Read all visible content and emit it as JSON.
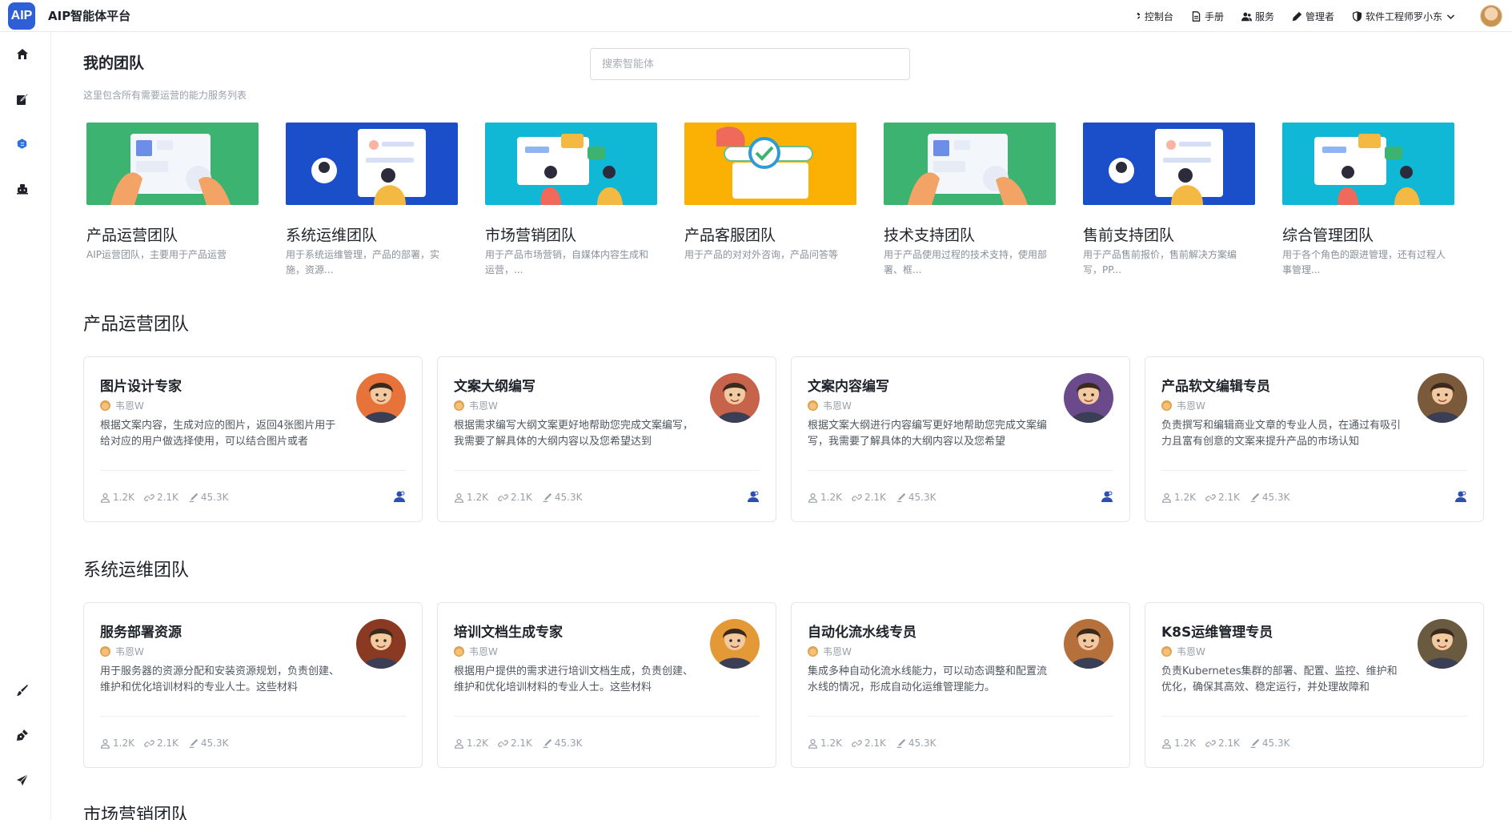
{
  "app": {
    "logo_text": "AIP",
    "title": "AIP智能体平台"
  },
  "top_nav": [
    {
      "label": "控制台",
      "icon": "tools-icon"
    },
    {
      "label": "手册",
      "icon": "document-icon"
    },
    {
      "label": "服务",
      "icon": "users-icon"
    },
    {
      "label": "管理者",
      "icon": "pen-icon"
    },
    {
      "label": "软件工程师罗小东",
      "icon": "shield-icon"
    }
  ],
  "sidebar": {
    "items": [
      {
        "icon": "home-icon"
      },
      {
        "icon": "edit-icon"
      },
      {
        "icon": "brain-icon"
      },
      {
        "icon": "bot-icon"
      },
      {
        "icon": "brush-icon"
      },
      {
        "icon": "pen-tool-icon"
      },
      {
        "icon": "send-icon"
      }
    ]
  },
  "page": {
    "title": "我的团队",
    "subtitle": "这里包含所有需要运营的能力服务列表",
    "search_placeholder": "搜索智能体"
  },
  "teams": [
    {
      "name": "产品运营团队",
      "desc": "AIP运营团队，主要用于产品运营",
      "color": "#3cb371"
    },
    {
      "name": "系统运维团队",
      "desc": "用于系统运维管理，产品的部署，实施，资源...",
      "color": "#1a4fc9"
    },
    {
      "name": "市场营销团队",
      "desc": "用于产品市场营销，自媒体内容生成和运营，...",
      "color": "#10b8d6"
    },
    {
      "name": "产品客服团队",
      "desc": "用于产品的对对外咨询，产品问答等",
      "color": "#fbb104"
    },
    {
      "name": "技术支持团队",
      "desc": "用于产品使用过程的技术支持，使用部署、框...",
      "color": "#3cb371"
    },
    {
      "name": "售前支持团队",
      "desc": "用于产品售前报价，售前解决方案编写，PP...",
      "color": "#1a4fc9"
    },
    {
      "name": "综合管理团队",
      "desc": "用于各个角色的跟进管理，还有过程人事管理...",
      "color": "#10b8d6"
    }
  ],
  "sections": [
    {
      "title": "产品运营团队",
      "agents": [
        {
          "title": "图片设计专家",
          "author": "韦恩W",
          "desc": "根据文案内容，生成对应的图片，返回4张图片用于给对应的用户做选择使用，可以结合图片或者",
          "stats": [
            "1.2K",
            "2.1K",
            "45.3K"
          ],
          "avatar_color": "#e8733a"
        },
        {
          "title": "文案大纲编写",
          "author": "韦恩W",
          "desc": "根据需求编写大纲文案更好地帮助您完成文案编写，我需要了解具体的大纲内容以及您希望达到",
          "stats": [
            "1.2K",
            "2.1K",
            "45.3K"
          ],
          "avatar_color": "#c6634a"
        },
        {
          "title": "文案内容编写",
          "author": "韦恩W",
          "desc": "根据文案大纲进行内容编写更好地帮助您完成文案编写，我需要了解具体的大纲内容以及您希望",
          "stats": [
            "1.2K",
            "2.1K",
            "45.3K"
          ],
          "avatar_color": "#6a4a8a"
        },
        {
          "title": "产品软文编辑专员",
          "author": "韦恩W",
          "desc": "负责撰写和编辑商业文章的专业人员，在通过有吸引力且富有创意的文案来提升产品的市场认知",
          "stats": [
            "1.2K",
            "2.1K",
            "45.3K"
          ],
          "avatar_color": "#7a5a3a"
        }
      ]
    },
    {
      "title": "系统运维团队",
      "agents": [
        {
          "title": "服务部署资源",
          "author": "韦恩W",
          "desc": "用于服务器的资源分配和安装资源规划，负责创建、维护和优化培训材料的专业人士。这些材料",
          "stats": [
            "1.2K",
            "2.1K",
            "45.3K"
          ],
          "avatar_color": "#8a3a22"
        },
        {
          "title": "培训文档生成专家",
          "author": "韦恩W",
          "desc": "根据用户提供的需求进行培训文档生成，负责创建、维护和优化培训材料的专业人士。这些材料",
          "stats": [
            "1.2K",
            "2.1K",
            "45.3K"
          ],
          "avatar_color": "#e39a36"
        },
        {
          "title": "自动化流水线专员",
          "author": "韦恩W",
          "desc": "集成多种自动化流水线能力，可以动态调整和配置流水线的情况，形成自动化运维管理能力。",
          "stats": [
            "1.2K",
            "2.1K",
            "45.3K"
          ],
          "avatar_color": "#b5703c"
        },
        {
          "title": "K8S运维管理专员",
          "author": "韦恩W",
          "desc": "负责Kubernetes集群的部署、配置、监控、维护和优化，确保其高效、稳定运行，并处理故障和",
          "stats": [
            "1.2K",
            "2.1K",
            "45.3K"
          ],
          "avatar_color": "#6a5a40"
        }
      ]
    },
    {
      "title": "市场营销团队",
      "agents": []
    }
  ]
}
